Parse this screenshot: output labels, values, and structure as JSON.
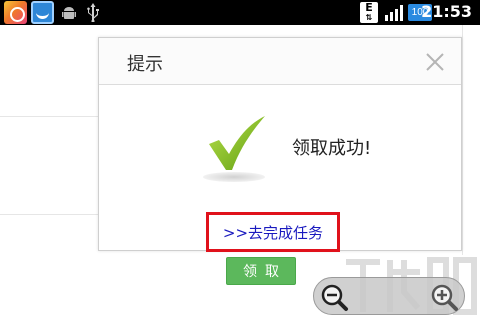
{
  "status_bar": {
    "time": "21:53",
    "battery": "100",
    "network_type": "E",
    "icons": [
      "app-icon",
      "app-icon",
      "android-debug-icon",
      "usb-icon",
      "signal-icon",
      "battery-icon"
    ]
  },
  "dialog": {
    "title": "提示",
    "message": "领取成功!",
    "task_link": ">>去完成任务"
  },
  "claim_button": {
    "label": "领取"
  },
  "colors": {
    "highlight_border": "#e0111b",
    "link": "#1a1abf",
    "button_green": "#5cb85c",
    "check_green": "#7cbc1c"
  }
}
